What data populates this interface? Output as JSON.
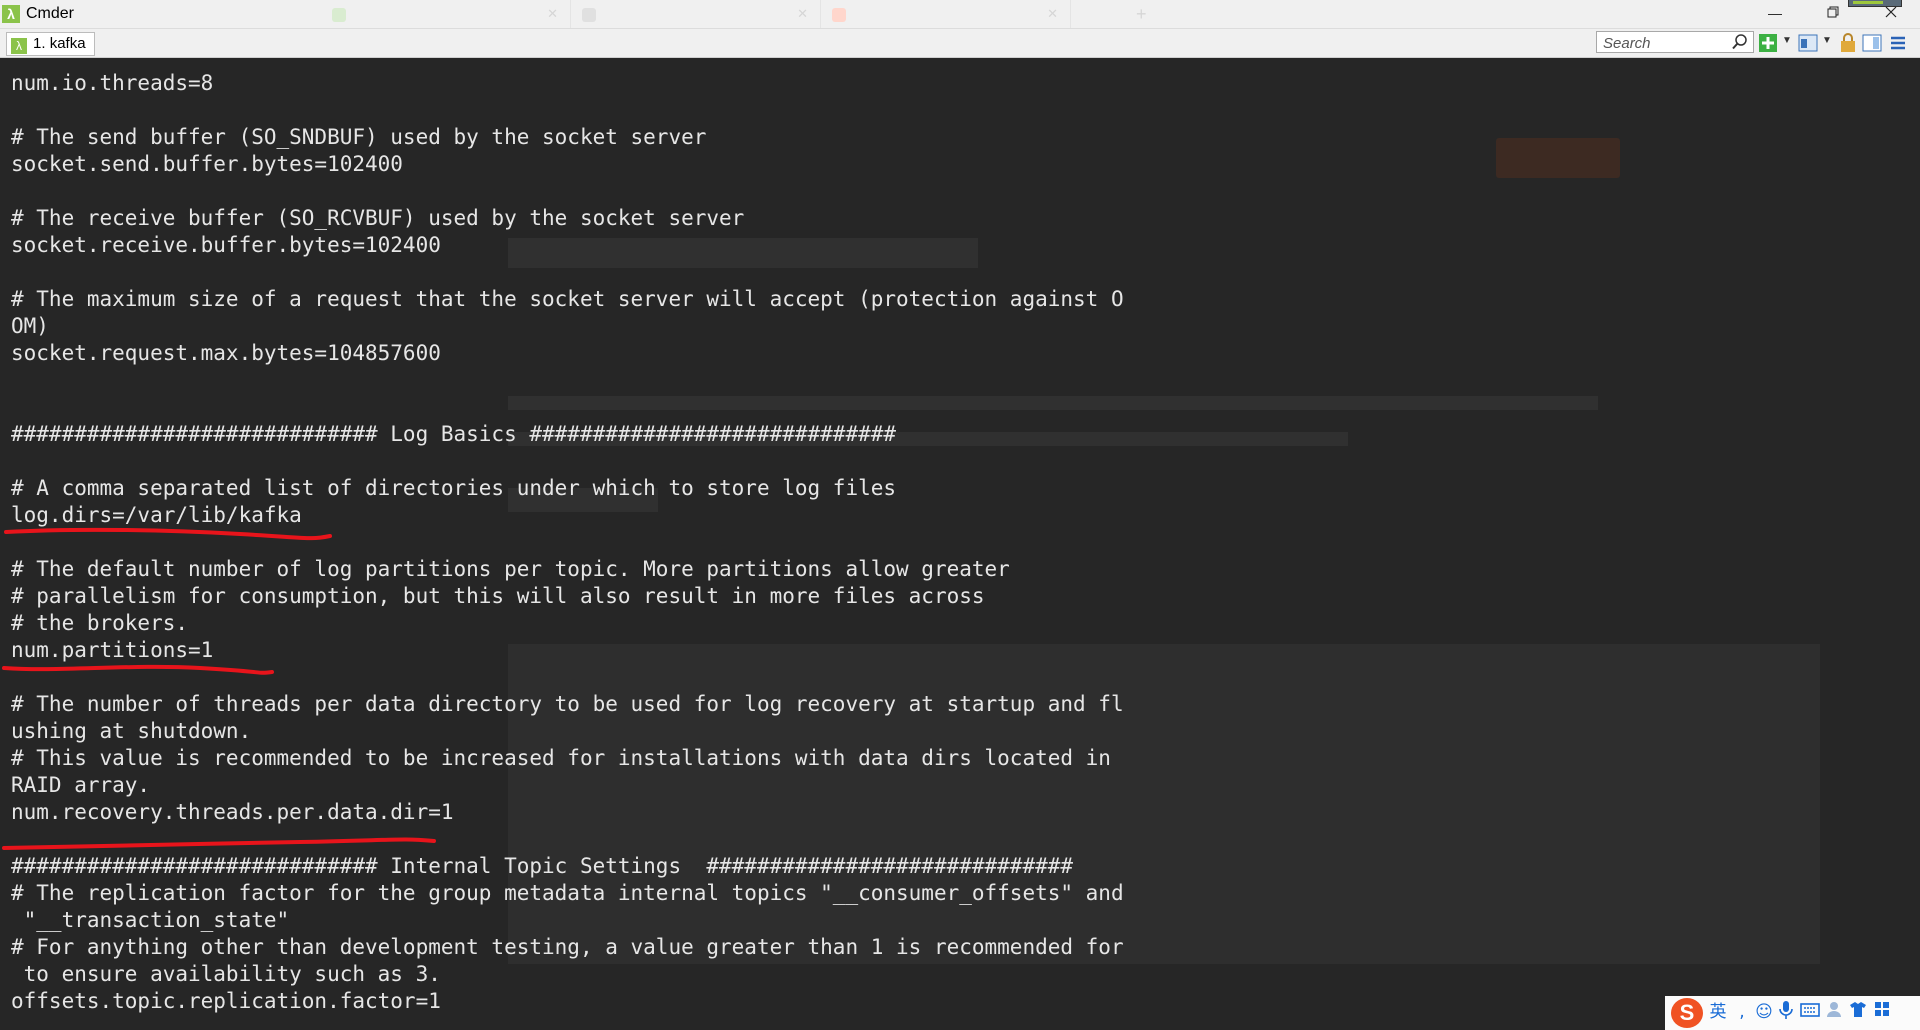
{
  "window": {
    "app_title": "Cmder",
    "app_icon": "lambda-icon",
    "controls": [
      "minimize",
      "restore",
      "close"
    ]
  },
  "tabbar": {
    "console_tab": {
      "index": "1.",
      "label": "kafka"
    },
    "search_placeholder": "Search"
  },
  "terminal": {
    "lines": [
      "num.io.threads=8",
      "",
      "# The send buffer (SO_SNDBUF) used by the socket server",
      "socket.send.buffer.bytes=102400",
      "",
      "# The receive buffer (SO_RCVBUF) used by the socket server",
      "socket.receive.buffer.bytes=102400",
      "",
      "# The maximum size of a request that the socket server will accept (protection against O",
      "OM)",
      "socket.request.max.bytes=104857600",
      "",
      "",
      "############################# Log Basics #############################",
      "",
      "# A comma separated list of directories under which to store log files",
      "log.dirs=/var/lib/kafka",
      "",
      "# The default number of log partitions per topic. More partitions allow greater",
      "# parallelism for consumption, but this will also result in more files across",
      "# the brokers.",
      "num.partitions=1",
      "",
      "# The number of threads per data directory to be used for log recovery at startup and fl",
      "ushing at shutdown.",
      "# This value is recommended to be increased for installations with data dirs located in",
      "RAID array.",
      "num.recovery.threads.per.data.dir=1",
      "",
      "############################# Internal Topic Settings  #############################",
      "# The replication factor for the group metadata internal topics \"__consumer_offsets\" and",
      " \"__transaction_state\"",
      "# For anything other than development testing, a value greater than 1 is recommended for",
      " to ensure availability such as 3.",
      "offsets.topic.replication.factor=1"
    ],
    "highlighted_lines": [
      "log.dirs=/var/lib/kafka",
      "num.partitions=1",
      "num.recovery.threads.per.data.dir=1"
    ],
    "annotation_color": "#e8141b",
    "text_color": "#e6e6e6",
    "background": "#262626"
  },
  "tray": {
    "ime_logo": "S",
    "ime_mode": "英",
    "icons": [
      "punctuation-icon",
      "emoji-icon",
      "microphone-icon",
      "keyboard-icon",
      "user-icon",
      "skin-icon",
      "grid-menu-icon"
    ]
  }
}
